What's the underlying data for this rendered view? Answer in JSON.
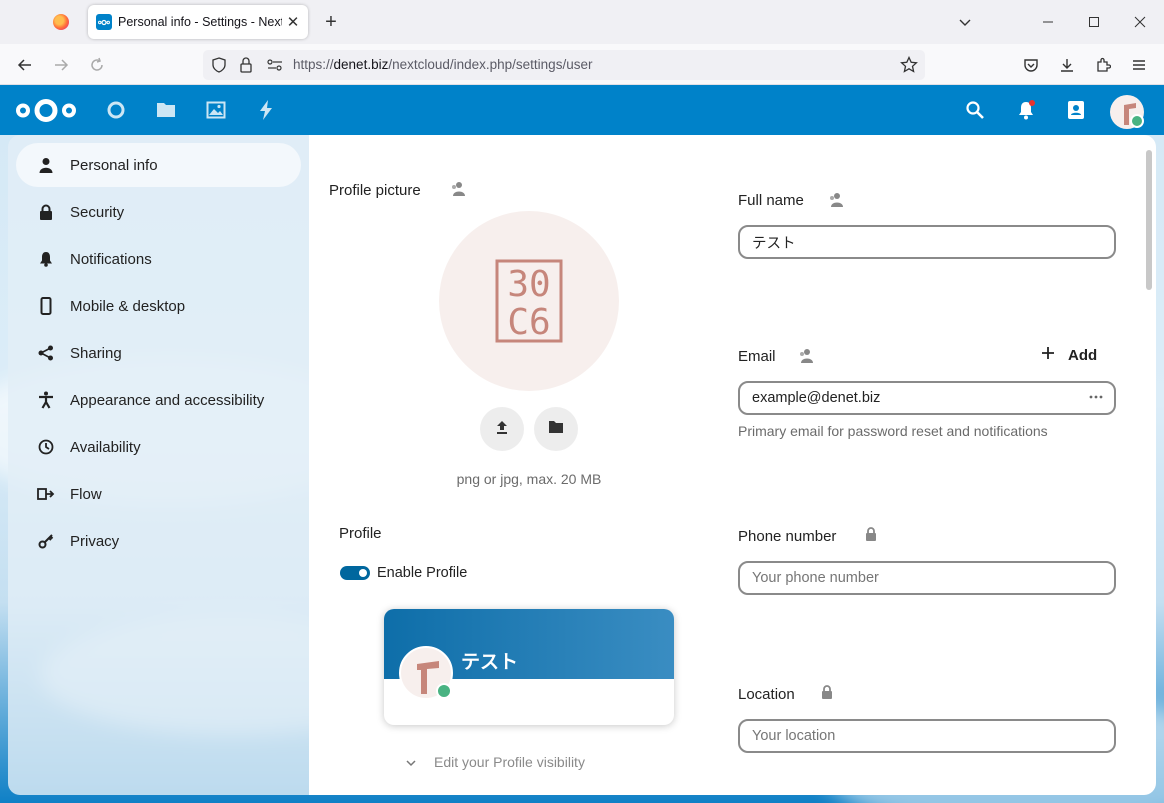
{
  "browser": {
    "tab_title": "Personal info - Settings - Nextcloud",
    "url_prefix": "https://",
    "url_host": "denet.biz",
    "url_path": "/nextcloud/index.php/settings/user",
    "new_tab_glyph": "+",
    "close_glyph": "✕"
  },
  "header": {
    "apps": [
      "dashboard-icon",
      "files-icon",
      "photos-icon",
      "activity-icon"
    ],
    "right_icons": [
      "search-icon",
      "bell-icon",
      "contacts-icon",
      "avatar"
    ],
    "brand_color": "#0082c9"
  },
  "sidebar": {
    "items": [
      {
        "label": "Personal info",
        "icon": "person-icon",
        "active": true
      },
      {
        "label": "Security",
        "icon": "lock-icon"
      },
      {
        "label": "Notifications",
        "icon": "bell-icon"
      },
      {
        "label": "Mobile & desktop",
        "icon": "phone-icon"
      },
      {
        "label": "Sharing",
        "icon": "share-icon"
      },
      {
        "label": "Appearance and accessibility",
        "icon": "accessibility-icon"
      },
      {
        "label": "Availability",
        "icon": "clock-icon"
      },
      {
        "label": "Flow",
        "icon": "flow-icon"
      },
      {
        "label": "Privacy",
        "icon": "key-icon"
      }
    ]
  },
  "profile_picture": {
    "label": "Profile picture",
    "avatar_text_line1": "30",
    "avatar_text_line2": "C6",
    "hint": "png or jpg, max. 20 MB"
  },
  "profile": {
    "label": "Profile",
    "toggle_label": "Enable Profile",
    "toggle_on": true,
    "card_name": "テスト",
    "visibility_link": "Edit your Profile visibility"
  },
  "fields": {
    "full_name": {
      "label": "Full name",
      "value": "テスト"
    },
    "email": {
      "label": "Email",
      "add_label": "Add",
      "value": "example@denet.biz",
      "hint": "Primary email for password reset and notifications"
    },
    "phone": {
      "label": "Phone number",
      "placeholder": "Your phone number"
    },
    "location": {
      "label": "Location",
      "placeholder": "Your location"
    }
  }
}
